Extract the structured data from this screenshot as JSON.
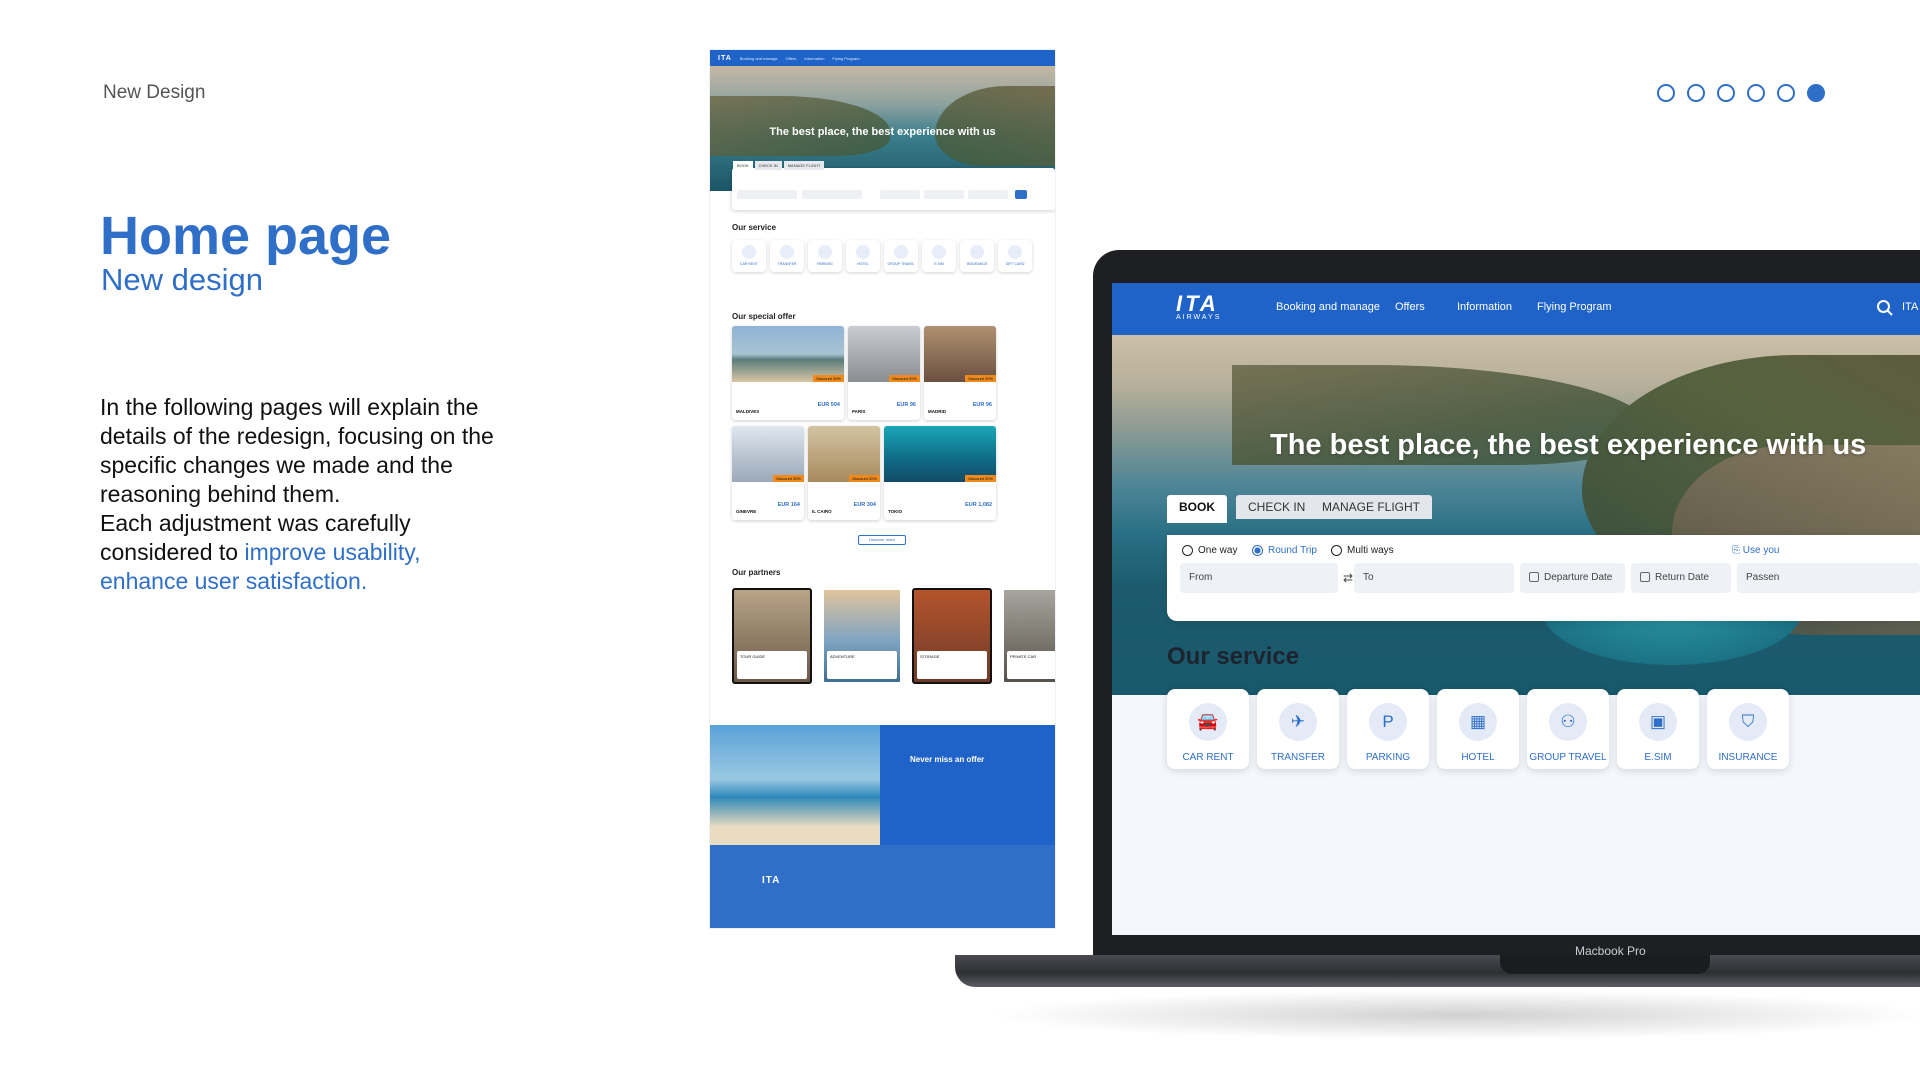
{
  "slide": {
    "kicker": "New Design",
    "title": "Home page",
    "subtitle": "New design",
    "body_lines": [
      "In the following pages will explain the",
      "details of the redesign, focusing on the",
      "specific changes we made and the",
      "reasoning behind them.",
      "Each adjustment was carefully",
      "considered to "
    ],
    "body_accent_1": "improve usability,",
    "body_accent_2": "enhance user satisfaction.",
    "pagination": {
      "total": 6,
      "active_index": 6
    }
  },
  "mock": {
    "logo": "ITA",
    "nav": [
      "Booking and manage",
      "Offers",
      "Information",
      "Flying Program"
    ],
    "hero_title": "The best place, the best experience with us",
    "tabs": [
      "BOOK",
      "CHECK IN",
      "MANAGE FLIGHT"
    ],
    "service_title": "Our service",
    "services": [
      "CAR RENT",
      "TRANSFER",
      "PARKING",
      "HOTEL",
      "GROUP TRAVEL",
      "E.SIM",
      "INSURANCE",
      "GIFT CARD"
    ],
    "offer_title": "Our special offer",
    "offers": [
      {
        "city": "MALDIVES",
        "price": "EUR 504",
        "tag": "Discount 30%"
      },
      {
        "city": "PARIS",
        "price": "EUR 96",
        "tag": "Discount 20%"
      },
      {
        "city": "MADRID",
        "price": "EUR 96",
        "tag": "Discount 20%"
      },
      {
        "city": "GINEVRE",
        "price": "EUR 164",
        "tag": "Discount 30%"
      },
      {
        "city": "IL CAIRO",
        "price": "EUR 304",
        "tag": "Discount 20%"
      },
      {
        "city": "TOKIO",
        "price": "EUR 1,082",
        "tag": "Discount 20%"
      }
    ],
    "discover": "Discover more",
    "partners_title": "Our partners",
    "partners": [
      "TOUR GUIDE",
      "ADVENTURE",
      "STORAGE",
      "PRIVATE CAR"
    ],
    "newsletter_title": "Never miss an offer",
    "footer_logo": "ITA"
  },
  "laptop": {
    "brand_big": "ITA",
    "brand_small": "AIRWAYS",
    "nav": [
      "Booking and manage",
      "Offers",
      "Information",
      "Flying Program"
    ],
    "lang": "ITA",
    "hero_title": "The best place, the best experience with us",
    "tabs": [
      "BOOK",
      "CHECK IN",
      "MANAGE FLIGHT"
    ],
    "trip_types": [
      "One way",
      "Round Trip",
      "Multi ways"
    ],
    "selected_trip": "Round Trip",
    "use_link": "Use you",
    "fields": {
      "from": "From",
      "to": "To",
      "departure": "Departure Date",
      "return": "Return Date",
      "passengers": "Passen"
    },
    "service_title": "Our service",
    "services": [
      "CAR RENT",
      "TRANSFER",
      "PARKING",
      "HOTEL",
      "GROUP TRAVEL",
      "E.SIM",
      "INSURANCE"
    ],
    "device_label": "Macbook Pro"
  },
  "colors": {
    "accent": "#2f6fc8",
    "nav": "#1f63c8",
    "discount": "#f08a1c"
  }
}
